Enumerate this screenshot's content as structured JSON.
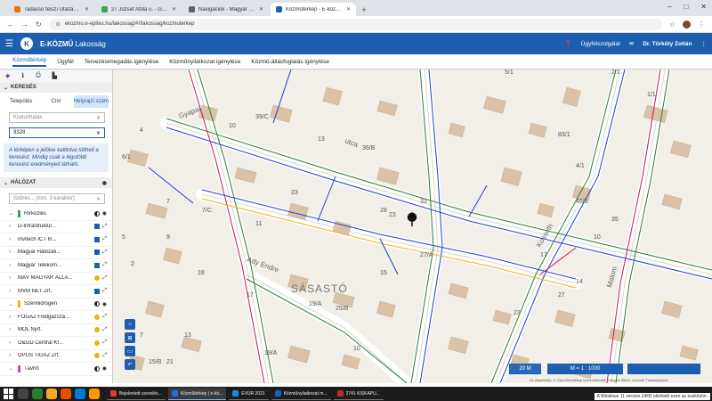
{
  "browser": {
    "tabs": [
      {
        "label": "Tadasso felszí Utazások és ez...",
        "color": "#e8710a"
      },
      {
        "label": "27 József Attila u. - Google Té...",
        "color": "#34a853"
      },
      {
        "label": "Navigációk - Magyar Sütiség...",
        "color": "#5f6368"
      },
      {
        "label": "Közműtérkép - E-közmű",
        "color": "#1d5eb0",
        "active": true
      }
    ],
    "url": "ekozmu.e-epites.hu/lakossag/#!/lakossag/kozmuterkep"
  },
  "app": {
    "logo_letter": "K",
    "name_bold": "E-KÖZMŰ",
    "name_rest": "Lakosság",
    "help_label": "Ügyfélszolgálat",
    "user_name": "Dr. Törköly Zoltán"
  },
  "menu": [
    "Közműtérkép",
    "Ügyfél",
    "Tervezésimegadás igénylése",
    "Közműnyilatkozat igénylése",
    "Közmű-állásfoglalás igénylése"
  ],
  "search": {
    "title": "KERESÉS",
    "segments": [
      "Település",
      "Cím",
      "Helyrajzi szám"
    ],
    "locality_placeholder": "Kiskunhalas",
    "hrsz_value": "9328",
    "hint": "A térképen a jelölve kattintva töltheti a keresést. Mindig csak a legutóbb keresést eredményeit látható."
  },
  "network": {
    "title": "HÁLÓZAT",
    "search_placeholder": "Szűrés... (min. 3 karakter)",
    "layers": [
      {
        "name": "Hírközlés",
        "group": true,
        "color": "#3aa64a",
        "ctl": "group"
      },
      {
        "name": "D-Infrastruktúr...",
        "ctl": "blue"
      },
      {
        "name": "Invitech ICT In...",
        "ctl": "blue"
      },
      {
        "name": "Magyar Hálózati...",
        "ctl": "blue"
      },
      {
        "name": "Magyar Telekom...",
        "ctl": "blue"
      },
      {
        "name": "MÁV MAGYAR ÁLLA...",
        "ctl": "orange"
      },
      {
        "name": "MVM NET Zrt.",
        "ctl": "blue"
      },
      {
        "name": "Szénhidrogén",
        "group": true,
        "color": "#e8b417",
        "ctl": "group"
      },
      {
        "name": "FŐGÁZ Földgázszá...",
        "ctl": "orange"
      },
      {
        "name": "MOL Nyrt.",
        "ctl": "orange"
      },
      {
        "name": "Ó&GD Central Kf...",
        "ctl": "orange"
      },
      {
        "name": "OPUS TIGÁZ Zrt.",
        "ctl": "orange"
      },
      {
        "name": "Távhő",
        "group": true,
        "color": "#d946a6",
        "ctl": "group"
      }
    ]
  },
  "map": {
    "district_label": "SÁSASTÓ",
    "street_labels": {
      "gyapai": "Gyapai",
      "utca": "utca",
      "ady": "Ady Endre",
      "malom": "Malom",
      "kossuth": "Kossuth"
    },
    "house_numbers": [
      "39/C",
      "36/B",
      "33",
      "5/1",
      "83/1",
      "10",
      "4",
      "13",
      "23",
      "7",
      "9",
      "7/C",
      "11",
      "6/1",
      "28",
      "15",
      "27/A",
      "23",
      "19/A",
      "10",
      "14",
      "17",
      "5",
      "2",
      "18",
      "17",
      "25/B",
      "19/A",
      "23",
      "13",
      "15/B",
      "7",
      "45/1",
      "21",
      "10",
      "4/1",
      "27",
      "35",
      "1/1",
      "2/1"
    ],
    "scale_label": "20 M",
    "ratio_label": "M = 1 : 1000",
    "attribution": "Az alaptérkép: © OpenStreetMap közreműködők, Magyar Állam, Lechner Tudásközpont"
  },
  "taskbar": {
    "apps": [
      {
        "label": "Bejelentett szerelés...",
        "color": "#e53935"
      },
      {
        "label": "Közműtérkép | e-kö...",
        "color": "#1a73e8",
        "active": true
      },
      {
        "label": "EVÜR 2021",
        "color": "#1e88e5"
      },
      {
        "label": "Közműnyilatkozat m...",
        "color": "#1565c0"
      },
      {
        "label": "2741 KISKAPU...",
        "color": "#c62828"
      }
    ],
    "notice": "A Windows 11 version 24H2 elérhető ezen az eszközön."
  }
}
